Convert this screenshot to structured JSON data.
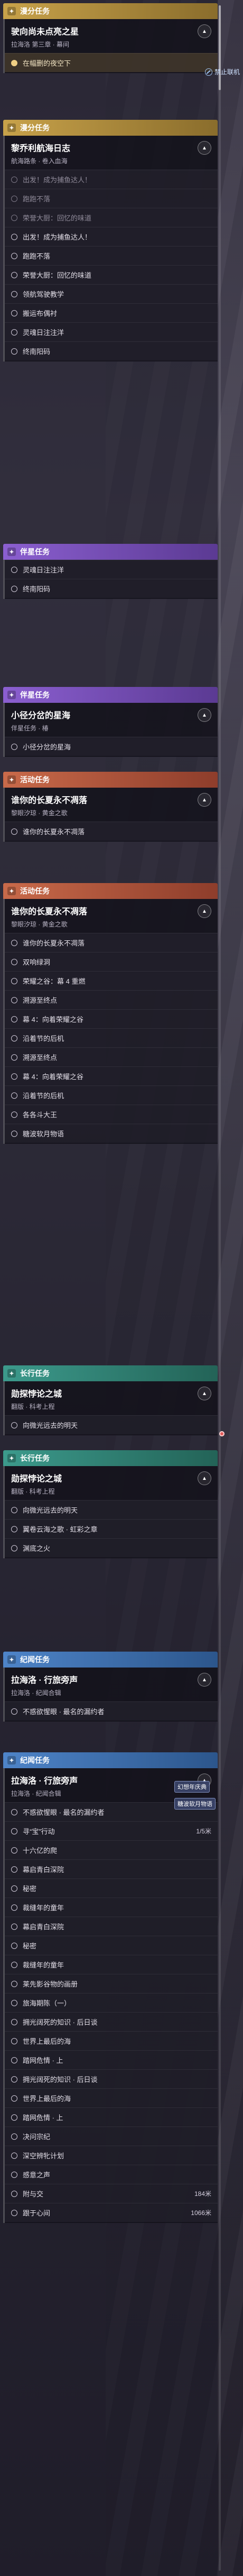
{
  "groups": [
    {
      "id": "g1",
      "color": "gold",
      "header": "漫分任务",
      "icon": "star-icon",
      "quests": [
        {
          "title": "驶向尚未点亮之星",
          "sub": "拉海洛 第三章 · 幕间",
          "steps": [
            {
              "text": "在幅删的夜空下",
              "state": "active"
            }
          ]
        }
      ]
    },
    {
      "id": "g2",
      "color": "gold",
      "header": "漫分任务",
      "icon": "star-icon",
      "quests": [
        {
          "title": "黎乔利航海日志",
          "sub": "航海路条 · 卷入血海",
          "steps": [
            {
              "text": "出发！成为捕鱼达人！",
              "state": "done"
            },
            {
              "text": "跑跑不落",
              "state": "done"
            },
            {
              "text": "荣誉大厨：回忆的味道",
              "state": "done"
            },
            {
              "text": "出发！成为捕鱼达人！",
              "state": "todo"
            },
            {
              "text": "跑跑不落",
              "state": "todo"
            },
            {
              "text": "荣誉大厨：回忆的味道",
              "state": "todo"
            },
            {
              "text": "领航驾驶教学",
              "state": "todo"
            },
            {
              "text": "搬运布偶衬",
              "state": "todo"
            },
            {
              "text": "灵魂日注注洋",
              "state": "todo"
            },
            {
              "text": "终南阳码",
              "state": "todo"
            }
          ]
        }
      ]
    },
    {
      "id": "g3",
      "color": "purple",
      "header": "伴星任务",
      "icon": "star-icon",
      "quests": [
        {
          "title": "",
          "sub": "",
          "steps": [
            {
              "text": "灵魂日注注洋",
              "state": "todo"
            },
            {
              "text": "终南阳码",
              "state": "todo"
            }
          ]
        }
      ]
    },
    {
      "id": "g4",
      "color": "purple",
      "header": "伴星任务",
      "icon": "star-icon",
      "quests": [
        {
          "title": "小径分岔的星海",
          "sub": "伴星任务 · 椿",
          "steps": [
            {
              "text": "小径分岔的星海",
              "state": "todo"
            }
          ]
        }
      ]
    },
    {
      "id": "g5",
      "color": "red",
      "header": "活动任务",
      "icon": "star-icon",
      "quests": [
        {
          "title": "谁你的长夏永不凋落",
          "sub": "黎眼汐琼 · 黄金之歌",
          "steps": [
            {
              "text": "谁你的长夏永不凋落",
              "state": "todo"
            }
          ]
        }
      ]
    },
    {
      "id": "g6",
      "color": "red",
      "header": "活动任务",
      "icon": "star-icon",
      "quests": [
        {
          "title": "谁你的长夏永不凋落",
          "sub": "黎眼汐琼 · 黄金之歌",
          "steps": [
            {
              "text": "谁你的长夏永不凋落",
              "state": "todo"
            },
            {
              "text": "双响绿洞",
              "state": "todo"
            },
            {
              "text": "荣耀之谷：幕 4 重燃",
              "state": "todo"
            },
            {
              "text": "溯源至终点",
              "state": "todo"
            },
            {
              "text": "幕 4：向着荣耀之谷",
              "state": "todo"
            },
            {
              "text": "沿着节的后机",
              "state": "todo"
            },
            {
              "text": "溯源至终点",
              "state": "todo"
            },
            {
              "text": "幕 4：向着荣耀之谷",
              "state": "todo"
            },
            {
              "text": "沿着节的后机",
              "state": "todo"
            },
            {
              "text": "各各斗大王",
              "state": "todo"
            },
            {
              "text": "糖波软月物语",
              "state": "todo"
            }
          ]
        }
      ]
    },
    {
      "id": "g7",
      "color": "teal",
      "header": "长行任务",
      "icon": "star-icon",
      "quests": [
        {
          "title": "勋探悖论之城",
          "sub": "翻版 · 科考上程",
          "steps": [
            {
              "text": "向微光远去的明天",
              "state": "todo"
            }
          ]
        }
      ]
    },
    {
      "id": "g8",
      "color": "teal",
      "header": "长行任务",
      "icon": "star-icon",
      "quests": [
        {
          "title": "勋探悖论之城",
          "sub": "翻版 · 科考上程",
          "steps": [
            {
              "text": "向微光远去的明天",
              "state": "todo"
            },
            {
              "text": "翼卷云海之歌 · 虹彩之章",
              "state": "todo"
            },
            {
              "text": "渊底之火",
              "state": "todo"
            }
          ]
        }
      ]
    },
    {
      "id": "g9",
      "color": "blue",
      "header": "纪闻任务",
      "icon": "star-icon",
      "quests": [
        {
          "title": "拉海洛 · 行旅旁声",
          "sub": "拉海洛 · 纪闻合辑",
          "steps": [
            {
              "text": "不惑欲惺眼 · 最名的漏约者",
              "state": "todo"
            }
          ]
        }
      ]
    },
    {
      "id": "g10",
      "color": "blue",
      "header": "纪闻任务",
      "icon": "star-icon",
      "quests": [
        {
          "title": "拉海洛 · 行旅旁声",
          "sub": "拉海洛 · 纪闻合辑",
          "steps": [
            {
              "text": "不惑欲惺眼 · 最名的漏约者",
              "state": "todo"
            },
            {
              "text": "寻“宝”行动",
              "state": "todo",
              "num": "1/5米"
            },
            {
              "text": "十六亿的爬",
              "state": "todo"
            },
            {
              "text": "幕启青白深院",
              "state": "todo"
            },
            {
              "text": "秘密",
              "state": "todo"
            },
            {
              "text": "裁缝年的童年",
              "state": "todo"
            },
            {
              "text": "幕启青白深院",
              "state": "todo"
            },
            {
              "text": "秘密",
              "state": "todo"
            },
            {
              "text": "裁缝年的童年",
              "state": "todo"
            },
            {
              "text": "莱先影谷物的画册",
              "state": "todo"
            },
            {
              "text": "旅海期陈（一）",
              "state": "todo"
            },
            {
              "text": "拥光阔死的知识 · 后日谈",
              "state": "todo"
            },
            {
              "text": "世界上最后的海",
              "state": "todo"
            },
            {
              "text": "踏网危情 · 上",
              "state": "todo"
            },
            {
              "text": "拥光阔死的知识 · 后日谈",
              "state": "todo"
            },
            {
              "text": "世界上最后的海",
              "state": "todo"
            },
            {
              "text": "踏网危情 · 上",
              "state": "todo"
            },
            {
              "text": "决问宗纪",
              "state": "todo"
            },
            {
              "text": "深空辨牝计划",
              "state": "todo"
            },
            {
              "text": "感意之声",
              "state": "todo"
            },
            {
              "text": "附与交",
              "state": "todo",
              "num": "184米"
            },
            {
              "text": "跟于心间",
              "state": "todo",
              "num": "1066米"
            }
          ]
        }
      ]
    }
  ],
  "floating": {
    "forbid_label": "禁止联机",
    "badge_1": "幻想年庆典",
    "badge_2": "糖波软月物语"
  }
}
